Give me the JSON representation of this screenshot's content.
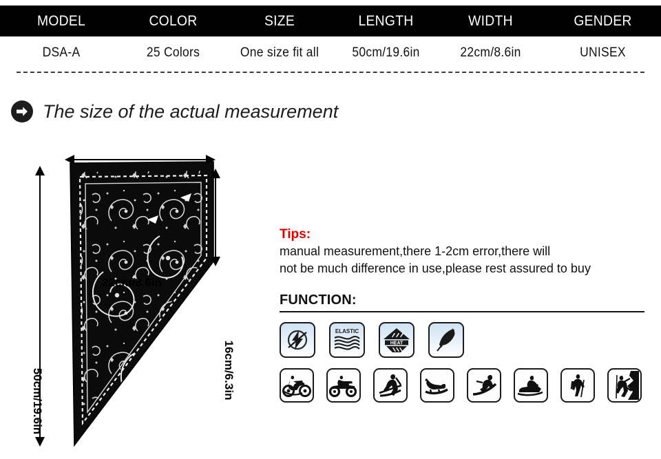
{
  "spec_table": {
    "headers": [
      "MODEL",
      "COLOR",
      "SIZE",
      "LENGTH",
      "WIDTH",
      "GENDER"
    ],
    "values": [
      "DSA-A",
      "25 Colors",
      "One size fit all",
      "50cm/19.6in",
      "22cm/8.6in",
      "UNISEX"
    ],
    "header_bar_color": "#000000",
    "header_text_color": "#ffffff"
  },
  "section": {
    "arrow_icon": "arrow-right-circle-icon",
    "heading": "The size of the actual measurement"
  },
  "diagram": {
    "width_label": "22cm/8.6in",
    "height_label": "50cm/19.6in",
    "side_label": "16cm/6.3in",
    "product_color": "#0b0b0b",
    "pattern": "paisley-bandana"
  },
  "tips": {
    "title": "Tips:",
    "title_color": "#e00000",
    "line1": "manual measurement,there 1-2cm error,there will",
    "line2": "not be much difference in use,please rest assured to buy"
  },
  "function": {
    "title": "FUNCTION:",
    "feature_icons": [
      {
        "name": "anti-static-icon",
        "label": ""
      },
      {
        "name": "elastic-icon",
        "label": "ELASTIC"
      },
      {
        "name": "heat-retention-icon",
        "label": "HEAT"
      },
      {
        "name": "lightweight-feather-icon",
        "label": ""
      }
    ],
    "activity_icons": [
      {
        "name": "motorcycle-icon"
      },
      {
        "name": "atv-quad-bike-icon"
      },
      {
        "name": "skiing-icon"
      },
      {
        "name": "sledding-luge-icon"
      },
      {
        "name": "snowboarding-icon"
      },
      {
        "name": "snowmobile-icon"
      },
      {
        "name": "hiking-icon"
      },
      {
        "name": "rock-climbing-icon"
      }
    ]
  }
}
